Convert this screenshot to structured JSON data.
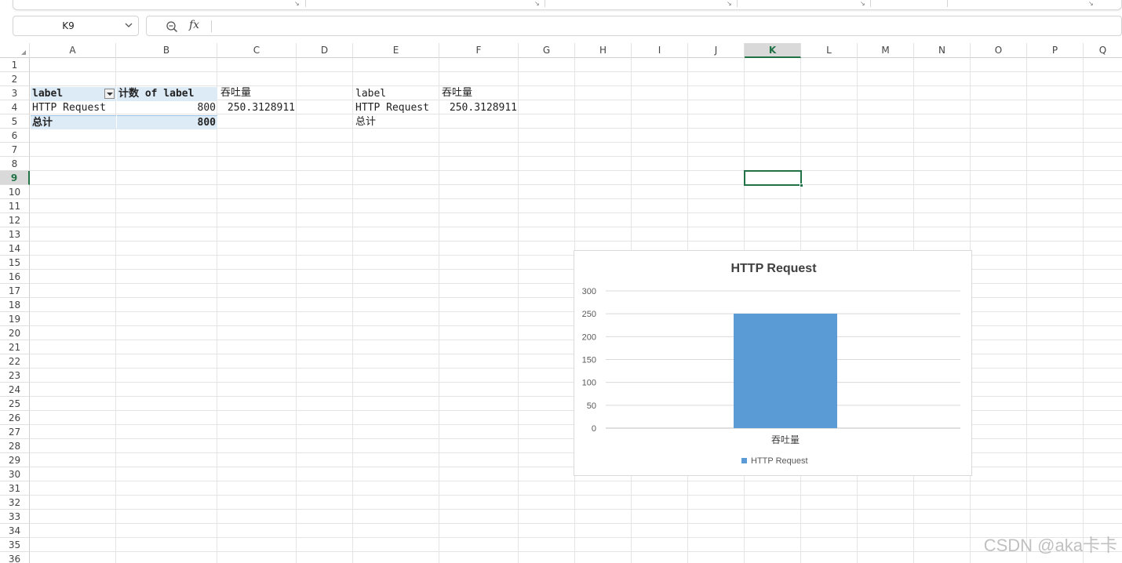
{
  "formula_bar": {
    "name_box": "K9",
    "fx_symbol": "fx",
    "formula": ""
  },
  "columns": [
    "A",
    "B",
    "C",
    "D",
    "E",
    "F",
    "G",
    "H",
    "I",
    "J",
    "K",
    "L",
    "M",
    "N",
    "O",
    "P",
    "Q"
  ],
  "active_column": "K",
  "active_row": "9",
  "rows": [
    "1",
    "2",
    "3",
    "4",
    "5",
    "6",
    "7",
    "8",
    "9",
    "10",
    "11",
    "12",
    "13",
    "14",
    "15",
    "16",
    "17",
    "18",
    "19",
    "20",
    "21",
    "22",
    "23",
    "24",
    "25",
    "26",
    "27",
    "28",
    "29",
    "30",
    "31",
    "32",
    "33",
    "34",
    "35",
    "36"
  ],
  "pivot_table": {
    "header_label": "label",
    "header_count": "计数 of label",
    "row_label": "HTTP Request",
    "row_count": "800",
    "total_label": "总计",
    "total_count": "800"
  },
  "cells": {
    "C3": "吞吐量",
    "C4": "250.3128911",
    "E3": "label",
    "F3": "吞吐量",
    "E4": "HTTP Request",
    "F4": "250.3128911",
    "E5": "总计"
  },
  "chart_data": {
    "type": "bar",
    "title": "HTTP Request",
    "categories": [
      "吞吐量"
    ],
    "series": [
      {
        "name": "HTTP Request",
        "values": [
          250.3128911
        ],
        "color": "#5b9bd5"
      }
    ],
    "ylim": [
      0,
      300
    ],
    "yticks": [
      "0",
      "50",
      "100",
      "150",
      "200",
      "250",
      "300"
    ],
    "grid": true,
    "legend": "bottom"
  },
  "watermark": "CSDN @aka卡卡",
  "colors": {
    "accent": "#217346",
    "pivot_fill": "#ddebf7",
    "bar": "#5b9bd5"
  }
}
